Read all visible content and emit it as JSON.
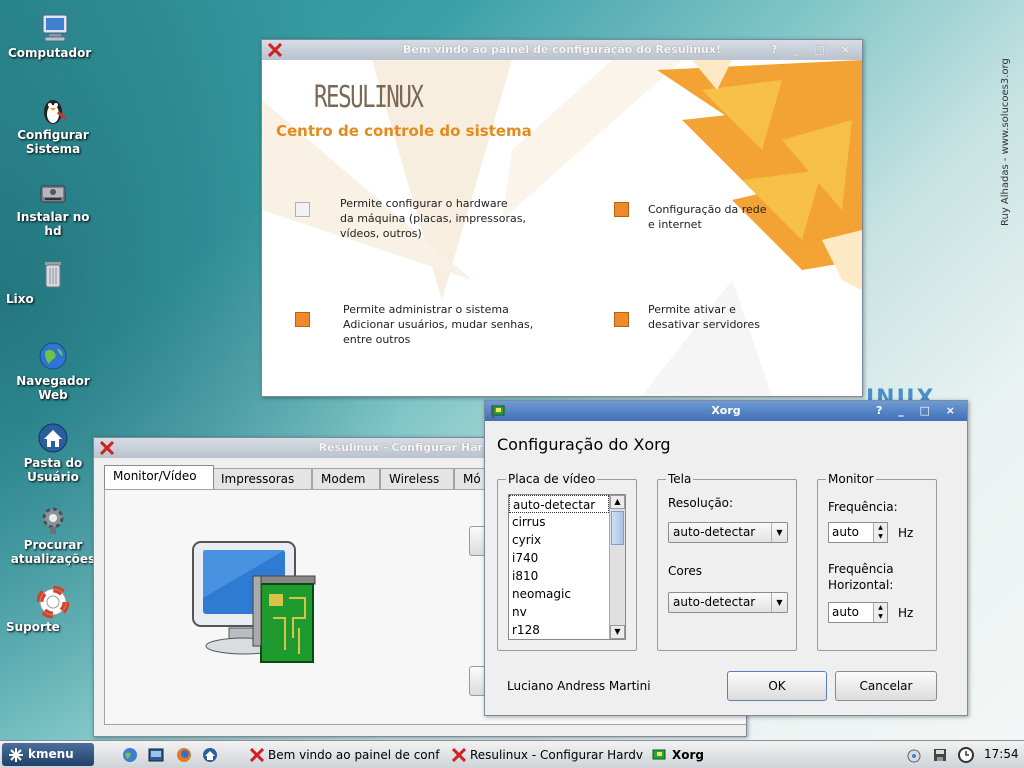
{
  "desktop": {
    "watermark": "Ruy Alhadas - www.solucoes3.org",
    "bg_logo_fragment": "INUX",
    "icons": [
      {
        "label": "Computador"
      },
      {
        "label": "Configurar Sistema"
      },
      {
        "label": "Instalar no hd"
      },
      {
        "label": "Lixo"
      },
      {
        "label": "Navegador Web"
      },
      {
        "label": "Pasta do Usuário"
      },
      {
        "label": "Procurar atualizações"
      },
      {
        "label": "Suporte"
      }
    ]
  },
  "welcome_window": {
    "title": "Bem vindo ao painel de configuração do Resulinux!",
    "title_buttons": "? _ □ ×",
    "brand": "RESULINUX",
    "subtitle": "Centro de controle do sistema",
    "options": [
      {
        "text_lines": [
          "Permite configurar o hardware",
          "da máquina (placas, impressoras,",
          "vídeos, outros)"
        ]
      },
      {
        "text_lines": [
          "Configuração da rede",
          "e internet"
        ]
      },
      {
        "text_lines": [
          "Permite administrar o sistema",
          "Adicionar usuários, mudar senhas,",
          "entre outros"
        ]
      },
      {
        "text_lines": [
          "Permite ativar e",
          "desativar servidores"
        ]
      }
    ]
  },
  "hardware_window": {
    "title": "Resulinux - Configurar Hardware",
    "tabs": [
      "Monitor/Vídeo",
      "Impressoras",
      "Modem",
      "Wireless",
      "Mó"
    ]
  },
  "xorg_dialog": {
    "title": "Xorg",
    "title_buttons": "? _ □ ×",
    "heading": "Configuração do Xorg",
    "video_card": {
      "label": "Placa de vídeo",
      "items": [
        "auto-detectar",
        "cirrus",
        "cyrix",
        "i740",
        "i810",
        "neomagic",
        "nv",
        "r128"
      ],
      "selected": "auto-detectar"
    },
    "screen": {
      "label": "Tela",
      "resolution_label": "Resolução:",
      "resolution_value": "auto-detectar",
      "colors_label": "Cores",
      "colors_value": "auto-detectar"
    },
    "monitor": {
      "label": "Monitor",
      "frequency_label": "Frequência:",
      "frequency_value": "auto",
      "frequency_unit": "Hz",
      "hfrequency_label_1": "Frequência",
      "hfrequency_label_2": "Horizontal:",
      "hfrequency_value": "auto",
      "hfrequency_unit": "Hz"
    },
    "author": "Luciano Andress Martini",
    "ok_label": "OK",
    "cancel_label": "Cancelar"
  },
  "taskbar": {
    "kmenu_label": "kmenu",
    "tasks": [
      {
        "label": "Bem vindo ao painel de conf"
      },
      {
        "label": "Resulinux - Configurar Hardv"
      },
      {
        "label": "Xorg"
      }
    ],
    "clock": "17:54"
  },
  "colors": {
    "titlebar_active": "#3f6fb6",
    "orange_accent": "#ef8a2a",
    "brand_orange": "#e58a1c"
  }
}
